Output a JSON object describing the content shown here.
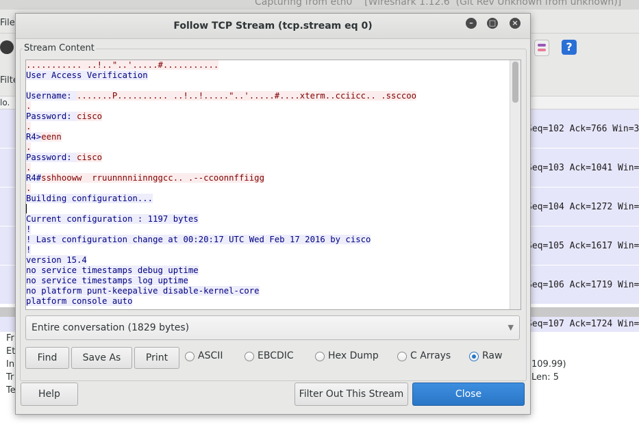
{
  "background_window": {
    "title": "Capturing from eth0    [Wireshark 1.12.6  (Git Rev Unknown from unknown)]",
    "menu_file": "File",
    "filter_label": "Filte",
    "list_header_no": "lo.",
    "rows": [
      "Seq=102 Ack=766 Win=3",
      "Seq=103 Ack=1041 Win=",
      "Seq=104 Ack=1272 Win=",
      "Seq=105 Ack=1617 Win=",
      "Seq=106 Ack=1719 Win=",
      "Seq=107 Ack=1724 Win="
    ],
    "details_left": [
      "Fr",
      "Et",
      "In",
      "Tr",
      "Te"
    ],
    "details_right": [
      "109.99)",
      "Len: 5"
    ]
  },
  "dialog": {
    "title": "Follow TCP Stream (tcp.stream eq 0)",
    "group_label": "Stream Content",
    "stream_lines": [
      [
        {
          "t": "........... ..!..\"..'.....#...........",
          "k": "c"
        }
      ],
      [
        {
          "t": "User Access Verification",
          "k": "s"
        }
      ],
      [
        {
          "t": "",
          "k": "s"
        }
      ],
      [
        {
          "t": "Username: ",
          "k": "s"
        },
        {
          "t": ".......P.......... ..!..!.....\"..'.....#....xterm..cciicc.. .ssccoo",
          "k": "c"
        }
      ],
      [
        {
          "t": ".",
          "k": "c"
        }
      ],
      [
        {
          "t": "Password: ",
          "k": "s"
        },
        {
          "t": "cisco",
          "k": "c"
        }
      ],
      [
        {
          "t": ".",
          "k": "c"
        }
      ],
      [
        {
          "t": "R4>",
          "k": "s"
        },
        {
          "t": "eenn",
          "k": "c"
        }
      ],
      [
        {
          "t": ".",
          "k": "c"
        }
      ],
      [
        {
          "t": "Password: ",
          "k": "s"
        },
        {
          "t": "cisco",
          "k": "c"
        }
      ],
      [
        {
          "t": ".",
          "k": "c"
        }
      ],
      [
        {
          "t": "R4#",
          "k": "s"
        },
        {
          "t": "sshhooww  rruunnnniinnggcc.. .--ccoonnffiigg",
          "k": "c"
        }
      ],
      [
        {
          "t": ".",
          "k": "c"
        }
      ],
      [
        {
          "t": "Building configuration...",
          "k": "s"
        }
      ],
      [
        {
          "t": "",
          "k": "s"
        }
      ],
      [
        {
          "t": "Current configuration : 1197 bytes",
          "k": "s"
        }
      ],
      [
        {
          "t": "!",
          "k": "s"
        }
      ],
      [
        {
          "t": "! Last configuration change at 00:20:17 UTC Wed Feb 17 2016 by cisco",
          "k": "s"
        }
      ],
      [
        {
          "t": "!",
          "k": "s"
        }
      ],
      [
        {
          "t": "version 15.4",
          "k": "s"
        }
      ],
      [
        {
          "t": "no service timestamps debug uptime",
          "k": "s"
        }
      ],
      [
        {
          "t": "no service timestamps log uptime",
          "k": "s"
        }
      ],
      [
        {
          "t": "no platform punt-keepalive disable-kernel-core",
          "k": "s"
        }
      ],
      [
        {
          "t": "platform console auto",
          "k": "s"
        }
      ]
    ],
    "conversation_select": "Entire conversation (1829 bytes)",
    "find_label": "Find",
    "save_as_label": "Save As",
    "print_label": "Print",
    "formats": [
      {
        "label": "ASCII",
        "selected": false
      },
      {
        "label": "EBCDIC",
        "selected": false
      },
      {
        "label": "Hex Dump",
        "selected": false
      },
      {
        "label": "C Arrays",
        "selected": false
      },
      {
        "label": "Raw",
        "selected": true
      }
    ],
    "help_label": "Help",
    "filter_out_label": "Filter Out This Stream",
    "close_label": "Close",
    "colors": {
      "client": "#800000",
      "server": "#000080",
      "accent": "#2a76c6"
    }
  }
}
